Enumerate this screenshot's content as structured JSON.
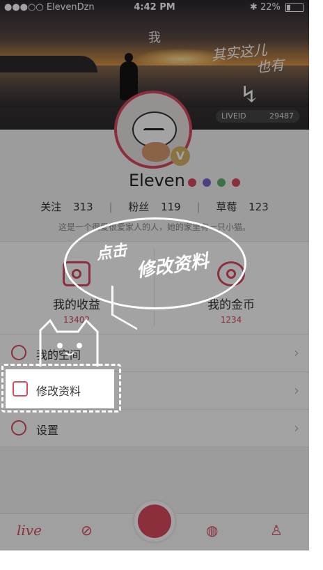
{
  "status_bar": {
    "carrier": "●●●○○ ElevenDzn",
    "time": "4:42 PM",
    "battery": "22%"
  },
  "header": {
    "title": "我",
    "liveid_label": "LIVEID",
    "liveid_value": "29487",
    "note_line1": "其实这儿",
    "note_line2": "也有"
  },
  "profile": {
    "name": "Eleven",
    "level_colors": [
      "#d84a5d",
      "#7c63c8",
      "#5fb36a",
      "#d84a5d"
    ],
    "following_label": "关注",
    "following_count": "313",
    "fans_label": "粉丝",
    "fans_count": "119",
    "strawberry_label": "草莓",
    "strawberry_count": "123",
    "bio": "这是一个很爱很爱家人的人，她的家里有一只小猫。"
  },
  "wallet": {
    "income_label": "我的收益",
    "income_value": "13402",
    "coins_label": "我的金币",
    "coins_value": "1234"
  },
  "menu": {
    "items": [
      {
        "label": "我的空间"
      },
      {
        "label": "修改资料"
      },
      {
        "label": "设置"
      }
    ]
  },
  "callout": {
    "line1": "点击",
    "line2": "修改资料"
  },
  "tabs": {
    "live_label": "live"
  },
  "colors": {
    "accent": "#d84a5d"
  }
}
